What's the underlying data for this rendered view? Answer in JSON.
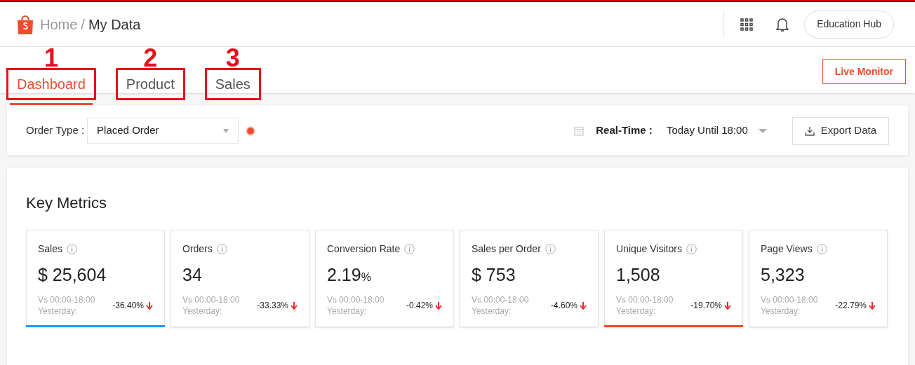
{
  "header": {
    "breadcrumb": [
      {
        "label": "Home",
        "current": false
      },
      {
        "label": "/",
        "current": false
      },
      {
        "label": "My Data",
        "current": true
      }
    ],
    "education_hub": "Education Hub"
  },
  "tabs": [
    {
      "label": "Dashboard",
      "selected": true,
      "annotation": "1"
    },
    {
      "label": "Product",
      "selected": false,
      "annotation": "2"
    },
    {
      "label": "Sales",
      "selected": false,
      "annotation": "3"
    }
  ],
  "live_monitor": "Live Monitor",
  "filters": {
    "order_type_label": "Order Type :",
    "order_type_value": "Placed Order",
    "period_label": "Real-Time :",
    "period_value": "Today Until 18:00",
    "export": "Export Data"
  },
  "key_metrics": {
    "title": "Key Metrics",
    "cards": [
      {
        "name": "Sales",
        "value": "$ 25,604",
        "compare": "Vs 00:00-18:00 Yesterday:",
        "change": "-36.40%",
        "selected": true,
        "color": "#2d9cee"
      },
      {
        "name": "Orders",
        "value": "34",
        "compare": "Vs 00:00-18:00 Yesterday:",
        "change": "-33.33%",
        "selected": false
      },
      {
        "name": "Conversion Rate",
        "value": "2.19",
        "unit": "%",
        "compare": "Vs 00:00-18:00 Yesterday:",
        "change": "-0.42%",
        "selected": false
      },
      {
        "name": "Sales per Order",
        "value": "$ 753",
        "compare": "Vs 00:00-18:00 Yesterday:",
        "change": "-4.60%",
        "selected": false
      },
      {
        "name": "Unique Visitors",
        "value": "1,508",
        "compare": "Vs 00:00-18:00 Yesterday:",
        "change": "-19.70%",
        "selected": true,
        "color": "#ee4d2d"
      },
      {
        "name": "Page Views",
        "value": "5,323",
        "compare": "Vs 00:00-18:00 Yesterday:",
        "change": "-22.79%",
        "selected": false
      }
    ]
  }
}
